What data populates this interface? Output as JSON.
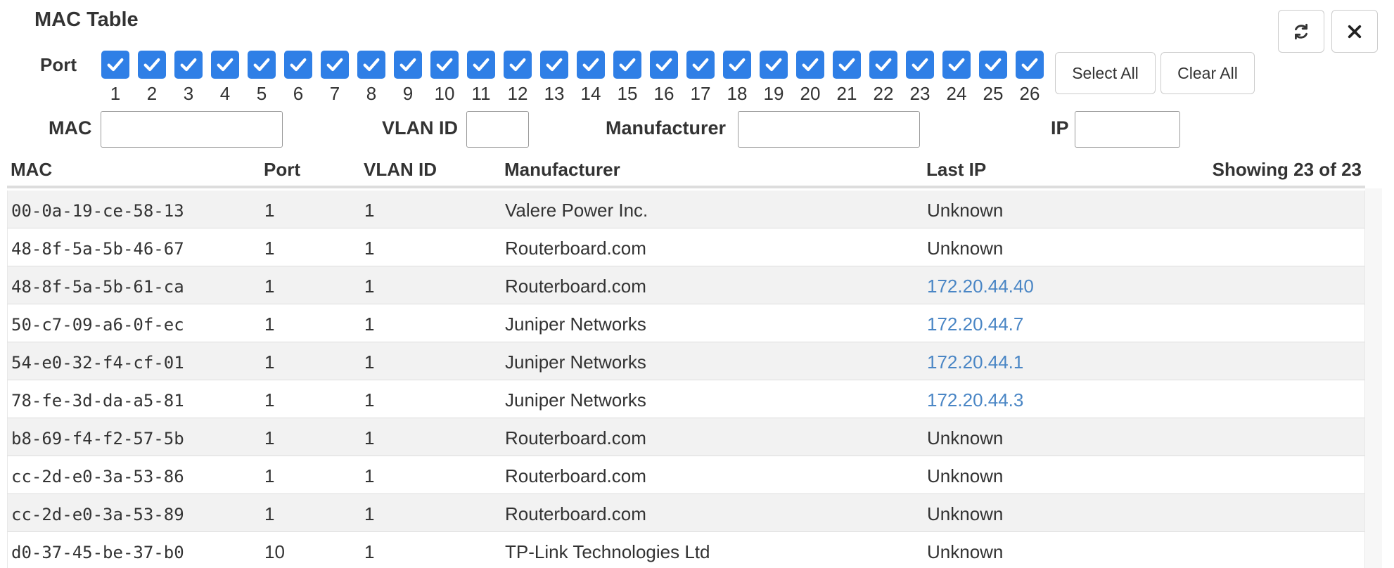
{
  "title": "MAC Table",
  "toolbar": {
    "refresh_icon": "refresh-icon",
    "close_icon": "close-icon"
  },
  "port_filter": {
    "label": "Port",
    "ports": [
      "1",
      "2",
      "3",
      "4",
      "5",
      "6",
      "7",
      "8",
      "9",
      "10",
      "11",
      "12",
      "13",
      "14",
      "15",
      "16",
      "17",
      "18",
      "19",
      "20",
      "21",
      "22",
      "23",
      "24",
      "25",
      "26"
    ],
    "checked": true,
    "select_all_label": "Select All",
    "clear_all_label": "Clear All"
  },
  "filters": {
    "mac_label": "MAC",
    "mac_value": "",
    "vlan_label": "VLAN ID",
    "vlan_value": "",
    "manufacturer_label": "Manufacturer",
    "manufacturer_value": "",
    "ip_label": "IP",
    "ip_value": ""
  },
  "table": {
    "headers": {
      "mac": "MAC",
      "port": "Port",
      "vlan": "VLAN ID",
      "manufacturer": "Manufacturer",
      "last_ip": "Last IP"
    },
    "showing": "Showing 23 of 23",
    "rows": [
      {
        "mac": "00-0a-19-ce-58-13",
        "port": "1",
        "vlan": "1",
        "manufacturer": "Valere Power Inc.",
        "last_ip": "Unknown",
        "ip_link": false
      },
      {
        "mac": "48-8f-5a-5b-46-67",
        "port": "1",
        "vlan": "1",
        "manufacturer": "Routerboard.com",
        "last_ip": "Unknown",
        "ip_link": false
      },
      {
        "mac": "48-8f-5a-5b-61-ca",
        "port": "1",
        "vlan": "1",
        "manufacturer": "Routerboard.com",
        "last_ip": "172.20.44.40",
        "ip_link": true
      },
      {
        "mac": "50-c7-09-a6-0f-ec",
        "port": "1",
        "vlan": "1",
        "manufacturer": "Juniper Networks",
        "last_ip": "172.20.44.7",
        "ip_link": true
      },
      {
        "mac": "54-e0-32-f4-cf-01",
        "port": "1",
        "vlan": "1",
        "manufacturer": "Juniper Networks",
        "last_ip": "172.20.44.1",
        "ip_link": true
      },
      {
        "mac": "78-fe-3d-da-a5-81",
        "port": "1",
        "vlan": "1",
        "manufacturer": "Juniper Networks",
        "last_ip": "172.20.44.3",
        "ip_link": true
      },
      {
        "mac": "b8-69-f4-f2-57-5b",
        "port": "1",
        "vlan": "1",
        "manufacturer": "Routerboard.com",
        "last_ip": "Unknown",
        "ip_link": false
      },
      {
        "mac": "cc-2d-e0-3a-53-86",
        "port": "1",
        "vlan": "1",
        "manufacturer": "Routerboard.com",
        "last_ip": "Unknown",
        "ip_link": false
      },
      {
        "mac": "cc-2d-e0-3a-53-89",
        "port": "1",
        "vlan": "1",
        "manufacturer": "Routerboard.com",
        "last_ip": "Unknown",
        "ip_link": false
      },
      {
        "mac": "d0-37-45-be-37-b0",
        "port": "10",
        "vlan": "1",
        "manufacturer": "TP-Link Technologies Ltd",
        "last_ip": "Unknown",
        "ip_link": false
      }
    ]
  },
  "colors": {
    "checkbox": "#2f7fe6",
    "link": "#4a86c5",
    "stripe": "#f2f2f2"
  }
}
